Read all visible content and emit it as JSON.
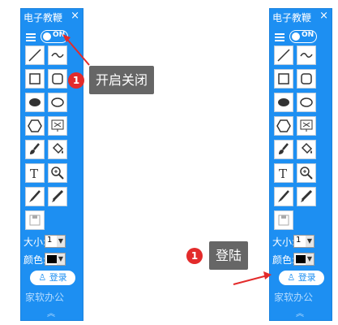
{
  "panel": {
    "title": "电子教鞭",
    "close": "×",
    "toggle": "ON",
    "size_label": "大小:",
    "size_value": "1",
    "color_label": "颜色:",
    "login_label": "登录",
    "brand": "家软办公",
    "chevron": "︽"
  },
  "callouts": {
    "toggle_callout": {
      "number": "1",
      "text": "开启关闭"
    },
    "login_callout": {
      "number": "1",
      "text": "登陆"
    }
  },
  "colors": {
    "panel_bg": "#1d8ff2",
    "badge": "#e32b2b",
    "callout_bg": "#666666"
  }
}
